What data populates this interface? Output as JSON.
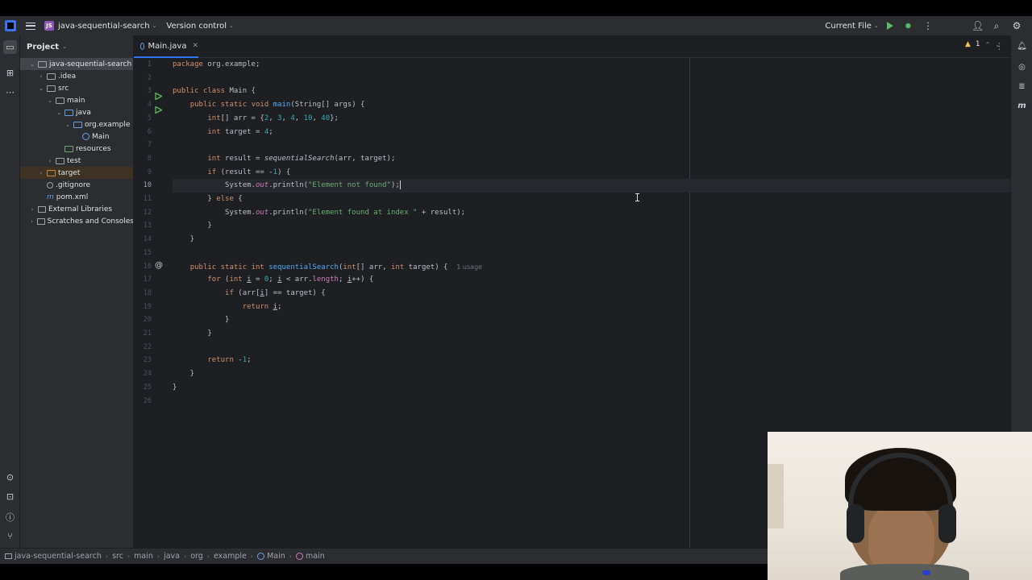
{
  "titlebar": {
    "project_badge": "JS",
    "project_name": "java-sequential-search",
    "vcs_label": "Version control",
    "run_config": "Current File"
  },
  "project_panel": {
    "title": "Project",
    "tree": [
      {
        "label": "java-sequential-search",
        "depth": 0,
        "arrow": "⌄",
        "icon": "folder-icon"
      },
      {
        "label": ".idea",
        "depth": 1,
        "arrow": "›",
        "icon": "folder-icon"
      },
      {
        "label": "src",
        "depth": 1,
        "arrow": "⌄",
        "icon": "folder-icon"
      },
      {
        "label": "main",
        "depth": 2,
        "arrow": "⌄",
        "icon": "folder-icon"
      },
      {
        "label": "java",
        "depth": 3,
        "arrow": "⌄",
        "icon": "source-folder-icon"
      },
      {
        "label": "org.example",
        "depth": 4,
        "arrow": "⌄",
        "icon": "package-icon"
      },
      {
        "label": "Main",
        "depth": 5,
        "arrow": "",
        "icon": "class-icon"
      },
      {
        "label": "resources",
        "depth": 3,
        "arrow": "",
        "icon": "resources-folder-icon"
      },
      {
        "label": "test",
        "depth": 2,
        "arrow": "›",
        "icon": "folder-icon"
      },
      {
        "label": "target",
        "depth": 1,
        "arrow": "›",
        "icon": "excluded-folder-icon"
      },
      {
        "label": ".gitignore",
        "depth": 1,
        "arrow": "",
        "icon": "gitignore-icon"
      },
      {
        "label": "pom.xml",
        "depth": 1,
        "arrow": "",
        "icon": "maven-icon"
      },
      {
        "label": "External Libraries",
        "depth": 0,
        "arrow": "›",
        "icon": "library-icon"
      },
      {
        "label": "Scratches and Consoles",
        "depth": 0,
        "arrow": "›",
        "icon": "scratches-icon"
      }
    ]
  },
  "editor": {
    "tab_label": "Main.java",
    "problems_count": "1",
    "current_line": 10,
    "usage_hint": "1 usage",
    "lines": [
      "package org.example;",
      "",
      "public class Main {",
      "    public static void main(String[] args) {",
      "        int[] arr = {2, 3, 4, 10, 40};",
      "        int target = 4;",
      "",
      "        int result = sequentialSearch(arr, target);",
      "        if (result == -1) {",
      "            System.out.println(\"Element not found\");",
      "        } else {",
      "            System.out.println(\"Element found at index \" + result);",
      "        }",
      "    }",
      "",
      "    public static int sequentialSearch(int[] arr, int target) {",
      "        for (int i = 0; i < arr.length; i++) {",
      "            if (arr[i] == target) {",
      "                return i;",
      "            }",
      "        }",
      "",
      "        return -1;",
      "    }",
      "}",
      ""
    ]
  },
  "statusbar": {
    "breadcrumbs": [
      "java-sequential-search",
      "src",
      "main",
      "java",
      "org",
      "example",
      "Main",
      "main"
    ]
  },
  "colors": {
    "keyword": "#cf8e6d",
    "number": "#2aacb8",
    "string": "#6aab73",
    "function": "#56a8f5",
    "field": "#c77dbb",
    "accent": "#3574f0"
  }
}
